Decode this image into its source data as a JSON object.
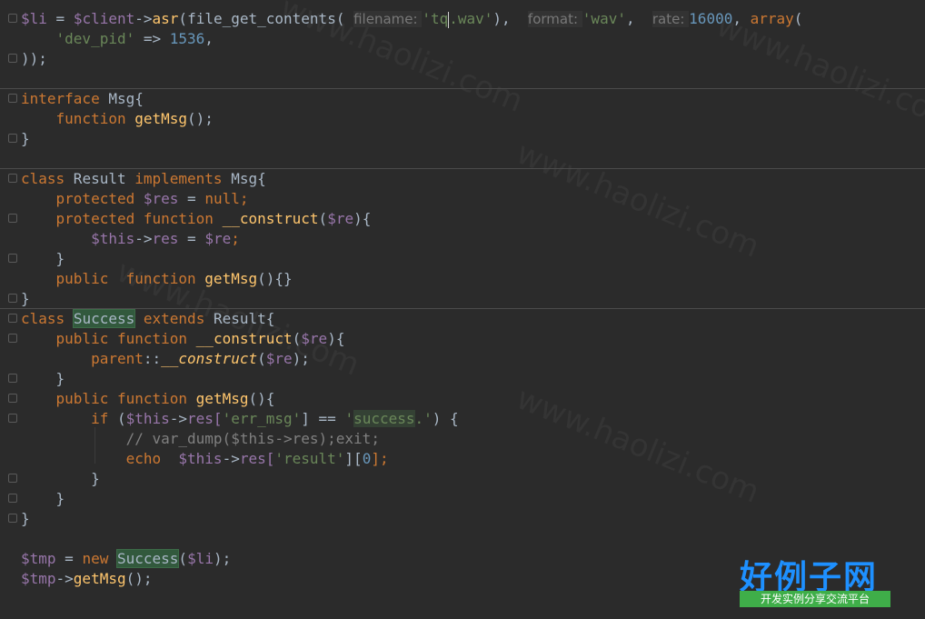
{
  "code": {
    "l1": {
      "var_li": "$li",
      "assign": " = ",
      "var_client": "$client",
      "arrow": "->",
      "asr": "asr",
      "open1": "(",
      "fgc": "file_get_contents",
      "open2": "( ",
      "hint_filename": "filename: ",
      "str_tq_a": "'tq",
      "str_tq_b": ".wav'",
      "close_comma": "),  ",
      "hint_format": "format: ",
      "str_wav": "'wav'",
      "comma2": ",  ",
      "hint_rate": "rate: ",
      "num_rate": "16000",
      "comma3": ", ",
      "array_kw": "array",
      "paren": "("
    },
    "l2": {
      "key": "'dev_pid'",
      "arrow": " => ",
      "val": "1536",
      "comma": ","
    },
    "l3": {
      "text": "));"
    },
    "l5": {
      "kw": "interface",
      "name": " Msg{"
    },
    "l6": {
      "kw": "function",
      "name": "getMsg",
      "rest": "();"
    },
    "l7": {
      "text": "}"
    },
    "l9": {
      "kw_class": "class",
      "name": " Result ",
      "kw_impl": "implements",
      "rest": " Msg{"
    },
    "l10": {
      "kw": "protected",
      "var": "$res",
      "eq": " = ",
      "null": "null",
      "semi": ";"
    },
    "l11": {
      "kw1": "protected",
      "kw2": "function",
      "name": "__construct",
      "open": "(",
      "var": "$re",
      "close": "){"
    },
    "l12": {
      "var1": "$this",
      "arrow": "->",
      "prop": "res",
      "eq": " = ",
      "var2": "$re",
      "semi": ";"
    },
    "l13": {
      "text": "}"
    },
    "l14": {
      "kw1": "public",
      "kw2": "function",
      "name": "getMsg",
      "rest": "(){}"
    },
    "l15": {
      "text": "}"
    },
    "l16": {
      "kw_class": "class",
      "name": "Success",
      "kw_ext": "extends",
      "rest": " Result{"
    },
    "l17": {
      "kw1": "public",
      "kw2": "function",
      "name": "__construct",
      "open": "(",
      "var": "$re",
      "close": "){"
    },
    "l18": {
      "kw": "parent",
      "sep": "::",
      "name": "__construct",
      "open": "(",
      "var": "$re",
      "close": ");"
    },
    "l19": {
      "text": "}"
    },
    "l20": {
      "kw1": "public",
      "kw2": "function",
      "name": "getMsg",
      "rest": "(){"
    },
    "l21": {
      "kw": "if",
      "open": " (",
      "var": "$this",
      "arrow": "->",
      "prop": "res[",
      "key": "'err_msg'",
      "mid": "] == ",
      "q1": "'",
      "val": "success",
      "q2": ".'",
      "close": ") {"
    },
    "l22": {
      "comment": "// var_dump($this->res);exit;"
    },
    "l23": {
      "kw": "echo",
      "var": "$this",
      "arrow": "->",
      "prop": "res[",
      "key": "'result'",
      "mid": "][",
      "num": "0",
      "close": "];"
    },
    "l24": {
      "text": "}"
    },
    "l25": {
      "text": "}"
    },
    "l26": {
      "text": "}"
    },
    "l28": {
      "var1": "$tmp",
      "eq": " = ",
      "kw": "new",
      "cls": "Success",
      "open": "(",
      "var2": "$li",
      "close": ");"
    },
    "l29": {
      "var": "$tmp",
      "arrow": "->",
      "name": "getMsg",
      "rest": "();"
    }
  },
  "logo": {
    "main": "好例子网",
    "sub": "开发实例分享交流平台"
  },
  "watermark": "www.haolizi.com",
  "colors": {
    "background": "#2b2b2b",
    "keyword": "#cc7832",
    "variable": "#9876aa",
    "function": "#ffc66d",
    "string": "#6a8759",
    "number": "#6897bb",
    "comment": "#808080",
    "logo_blue": "#1e90ff",
    "logo_green": "#3fae49"
  }
}
